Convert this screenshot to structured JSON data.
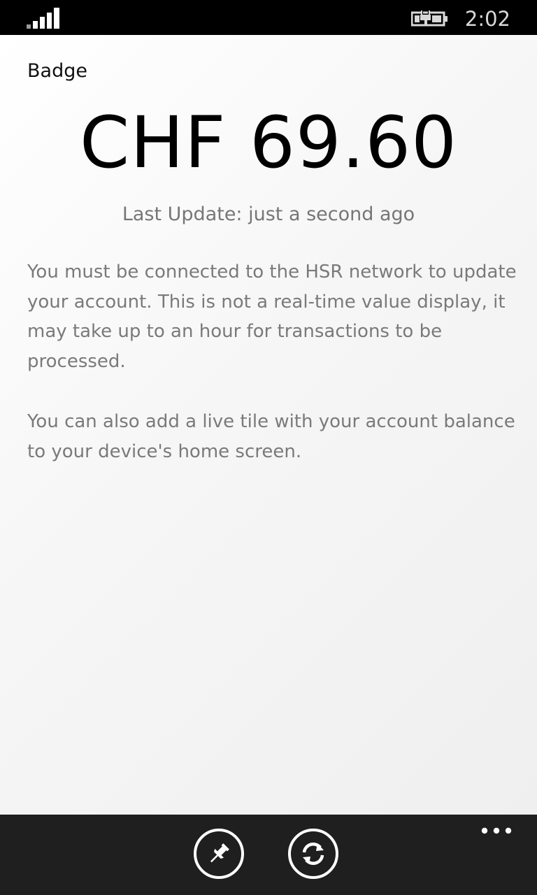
{
  "status_bar": {
    "time": "2:02",
    "signal_icon": "signal-strength-icon",
    "battery_icon": "battery-charging-icon"
  },
  "page": {
    "title": "Badge",
    "balance": "CHF 69.60",
    "last_update": "Last Update: just a second ago",
    "info_paragraph_1": "You must be connected to the HSR network to update your account. This is not a real-time value display, it may take up to an hour for transactions to be processed.",
    "info_paragraph_2": "You can also add a live tile with your account balance to your device's home screen."
  },
  "app_bar": {
    "buttons": [
      {
        "icon": "pin-icon"
      },
      {
        "icon": "refresh-icon"
      }
    ],
    "more_icon": "more-dots-icon"
  },
  "colors": {
    "background": "#f5f5f5",
    "app_bar": "#1f1f1f",
    "secondary_text": "#767676"
  }
}
